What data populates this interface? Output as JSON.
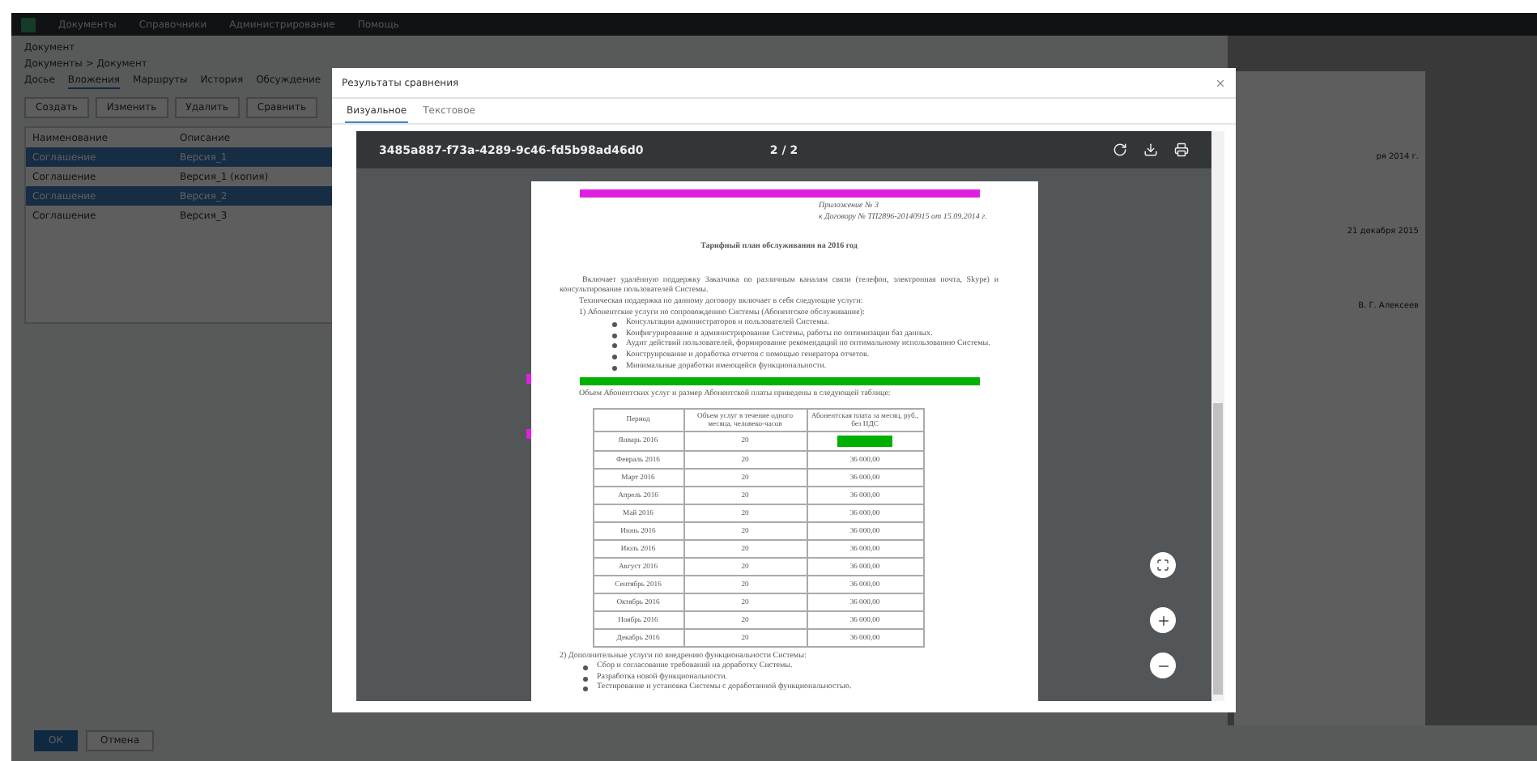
{
  "app": {
    "nav": [
      "Документы",
      "Справочники",
      "Администрирование",
      "Помощь"
    ],
    "heading": "Документ",
    "breadcrumb": "Документы > Документ",
    "tabs": [
      {
        "label": "Досье",
        "selected": false
      },
      {
        "label": "Вложения",
        "selected": true
      },
      {
        "label": "Маршруты",
        "selected": false
      },
      {
        "label": "История",
        "selected": false
      },
      {
        "label": "Обсуждение",
        "selected": false
      }
    ],
    "toolbar": [
      "Создать",
      "Изменить",
      "Удалить",
      "Сравнить"
    ],
    "table": {
      "columns": [
        "Наименование",
        "Описание"
      ],
      "rows": [
        {
          "cells": [
            "Соглашение",
            "Версия_1"
          ],
          "selected": true
        },
        {
          "cells": [
            "Соглашение",
            "Версия_1 (копия)"
          ],
          "selected": false
        },
        {
          "cells": [
            "Соглашение",
            "Версия_2"
          ],
          "selected": true
        },
        {
          "cells": [
            "Соглашение",
            "Версия_3"
          ],
          "selected": false
        }
      ]
    },
    "preview_lines": [
      "ря 2014 г.",
      "21 декабря 2015",
      "В. Г. Алексеев"
    ],
    "footer_buttons": [
      {
        "label": "ОК",
        "kind": "primary"
      },
      {
        "label": "Отмена",
        "kind": "secondary"
      }
    ]
  },
  "modal": {
    "title": "Результаты сравнения",
    "tabs": [
      {
        "label": "Визуальное",
        "selected": true
      },
      {
        "label": "Текстовое",
        "selected": false
      }
    ],
    "viewer": {
      "file": "3485a887-f73a-4289-9c46-fd5b98ad46d0",
      "page": "2 / 2",
      "document": {
        "blocks": [
          {
            "kind": "bar",
            "color": "#e020e0"
          },
          {
            "kind": "right",
            "text": "Приложение № 3"
          },
          {
            "kind": "right",
            "text": "к Договору № ТП2896-20140915 от 15.09.2014 г."
          },
          {
            "kind": "title",
            "text": "Тарифный план обслуживания на 2016 год"
          },
          {
            "kind": "para",
            "text": "Включает удалённую поддержку Заказчика по различным каналам связи (телефон, электронная почта, Skype) и консультирование пользователей Системы."
          },
          {
            "kind": "indent",
            "text": "Техническая поддержка по данному договору включает в себя следующие услуги:"
          },
          {
            "kind": "indent",
            "text": "1) Абонентские услуги по сопровождению Системы (Абонентское обслуживание):"
          },
          {
            "kind": "bullet",
            "text": "Консультации администраторов и пользователей Системы."
          },
          {
            "kind": "bullet",
            "text": "Конфигурирование и администрирование Системы, работы по оптимизации баз данных."
          },
          {
            "kind": "bullet",
            "text": "Аудит действий пользователей, формирование рекомендаций по оптимальному использованию Системы."
          },
          {
            "kind": "bullet",
            "text": "Конструирование и доработка отчетов с помощью генератора отчетов."
          },
          {
            "kind": "bullet",
            "text": "Минимальные доработки имеющейся функциональности."
          },
          {
            "kind": "bar",
            "color": "#00b000",
            "margin_mark": true
          },
          {
            "kind": "indent",
            "text": "Объем Абонентских услуг и размер Абонентской платы приведены в следующей таблице:"
          }
        ],
        "table": {
          "columns": [
            "Период",
            "Объем услуг в течение одного месяца, человеко-часов",
            "Абонентская плата за месяц, руб., без НДС"
          ],
          "rows": [
            {
              "cells": [
                "Январь 2016",
                "20",
                ""
              ],
              "changed": true
            },
            {
              "cells": [
                "Февраль 2016",
                "20",
                "36 000,00"
              ],
              "changed": false
            },
            {
              "cells": [
                "Март 2016",
                "20",
                "36 000,00"
              ],
              "changed": false
            },
            {
              "cells": [
                "Апрель 2016",
                "20",
                "36 000,00"
              ],
              "changed": false
            },
            {
              "cells": [
                "Май 2016",
                "20",
                "36 000,00"
              ],
              "changed": false
            },
            {
              "cells": [
                "Июнь 2016",
                "20",
                "36 000,00"
              ],
              "changed": false
            },
            {
              "cells": [
                "Июль 2016",
                "20",
                "36 000,00"
              ],
              "changed": false
            },
            {
              "cells": [
                "Август 2016",
                "20",
                "36 000,00"
              ],
              "changed": false
            },
            {
              "cells": [
                "Сентябрь 2016",
                "20",
                "36 000,00"
              ],
              "changed": false
            },
            {
              "cells": [
                "Октябрь 2016",
                "20",
                "36 000,00"
              ],
              "changed": false
            },
            {
              "cells": [
                "Ноябрь 2016",
                "20",
                "36 000,00"
              ],
              "changed": false
            },
            {
              "cells": [
                "Декабрь 2016",
                "20",
                "36 000,00"
              ],
              "changed": false
            }
          ]
        },
        "after": [
          {
            "kind": "plain",
            "text": "2) Дополнительные услуги по внедрению функциональности Системы:"
          },
          {
            "kind": "bullet",
            "text": "Сбор и согласование требований на доработку Системы."
          },
          {
            "kind": "bullet",
            "text": "Разработка новой функциональности."
          },
          {
            "kind": "bullet",
            "text": "Тестирование и установка Системы с доработанной функциональностью."
          }
        ]
      }
    }
  }
}
